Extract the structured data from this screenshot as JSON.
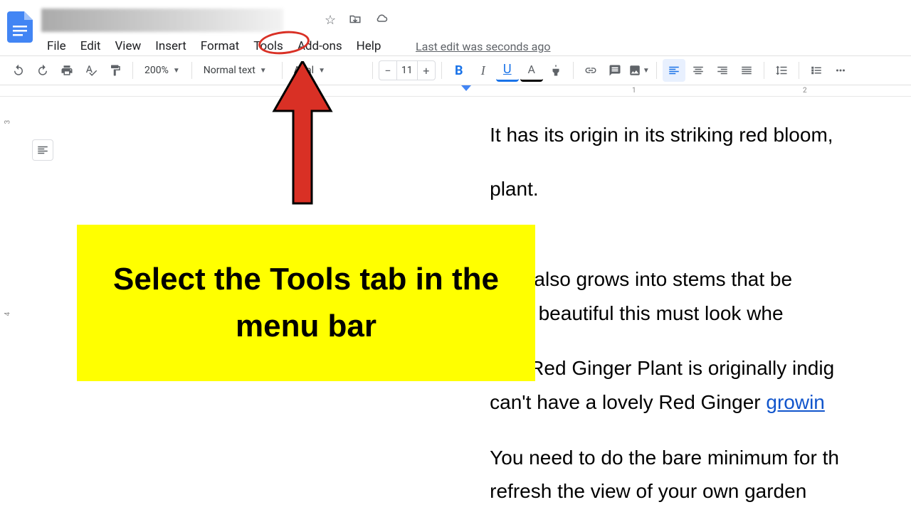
{
  "header": {
    "menu": {
      "file": "File",
      "edit": "Edit",
      "view": "View",
      "insert": "Insert",
      "format": "Format",
      "tools": "Tools",
      "addons": "Add-ons",
      "help": "Help"
    },
    "last_edit": "Last edit was seconds ago"
  },
  "toolbar": {
    "zoom": "200%",
    "style": "Normal text",
    "font": "Arial",
    "font_size": "11",
    "bold": "B",
    "italic": "I",
    "underline": "U",
    "text_color": "A"
  },
  "ruler": {
    "mark1": "1",
    "mark2": "2"
  },
  "vruler": {
    "mark3": "3",
    "mark4": "4"
  },
  "document": {
    "p1": "It has its origin in its striking red bloom,",
    "p2": "plant.",
    "p3a": "hoot also grows into stems that be",
    "p3b": "tterly beautiful this must look whe",
    "p4a_pre": "The Red Ginger Plant is originally indig",
    "p4b_pre": "can't have a lovely Red Ginger ",
    "p4b_link": "growin",
    "p5": "You need to do the bare minimum for th",
    "p6": "refresh the view of your own garden"
  },
  "annotation": {
    "callout": "Select the Tools tab in the menu bar"
  }
}
